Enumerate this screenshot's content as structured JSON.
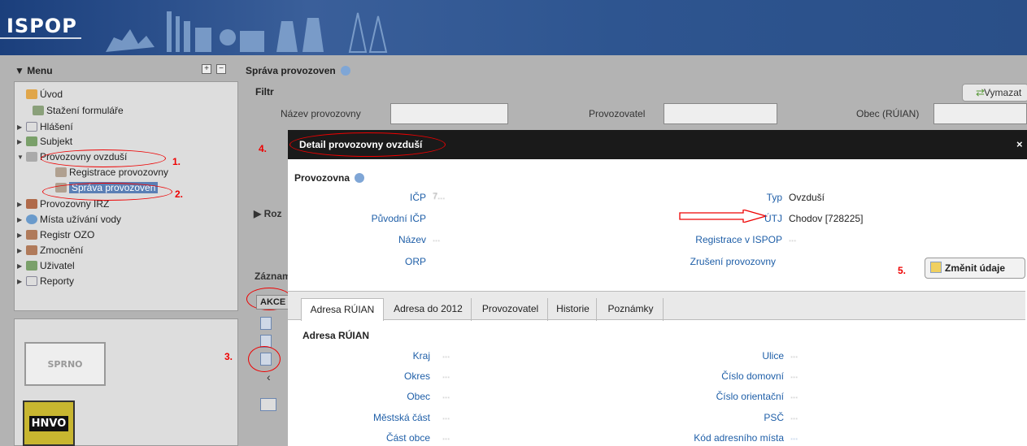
{
  "header": {
    "logo": "ISPOP"
  },
  "menu": {
    "title": "▼ Menu",
    "items": [
      {
        "label": "Úvod"
      },
      {
        "label": "Stažení formuláře"
      },
      {
        "label": "Hlášení"
      },
      {
        "label": "Subjekt"
      },
      {
        "label": "Provozovny ovzduší"
      },
      {
        "label": "Registrace provozovny"
      },
      {
        "label": "Správa provozoven"
      },
      {
        "label": "Provozovny IRZ"
      },
      {
        "label": "Místa užívání vody"
      },
      {
        "label": "Registr OZO"
      },
      {
        "label": "Zmocnění"
      },
      {
        "label": "Uživatel"
      },
      {
        "label": "Reporty"
      }
    ]
  },
  "logos": {
    "first": "SPRNO",
    "second": "HNVO"
  },
  "section": {
    "title": "Správa provozoven",
    "filter": "Filtr",
    "clear": "Vymazat",
    "fields": {
      "name": "Název provozovny",
      "operator": "Provozovatel",
      "municipality": "Obec (RÚIAN)"
    },
    "expand": "▶ Roz",
    "records": "Záznam",
    "actions": "AKCE"
  },
  "annotations": {
    "n1": "1.",
    "n2": "2.",
    "n3": "3.",
    "n4": "4.",
    "n5": "5."
  },
  "modal": {
    "title": "Detail provozovny ovzduší",
    "close": "×",
    "provozovna": "Provozovna",
    "icp_label": "IČP",
    "icp_value": "7...",
    "puvodni_icp_label": "Původní IČP",
    "nazev_label": "Název",
    "nazev_value": "...",
    "orp_label": "ORP",
    "typ_label": "Typ",
    "typ_value": "Ovzduší",
    "utj_label": "ÚTJ",
    "utj_value": "Chodov [728225]",
    "registrace_label": "Registrace v ISPOP",
    "registrace_value": "...",
    "zruseni_label": "Zrušení provozovny",
    "change_button": "Změnit údaje",
    "tabs": [
      "Adresa RÚIAN",
      "Adresa do 2012",
      "Provozovatel",
      "Historie",
      "Poznámky"
    ],
    "address_title": "Adresa RÚIAN",
    "address_left": [
      {
        "label": "Kraj",
        "value": "..."
      },
      {
        "label": "Okres",
        "value": "..."
      },
      {
        "label": "Obec",
        "value": "..."
      },
      {
        "label": "Městská část",
        "value": "..."
      },
      {
        "label": "Část obce",
        "value": "..."
      }
    ],
    "address_right": [
      {
        "label": "Ulice",
        "value": "..."
      },
      {
        "label": "Číslo domovní",
        "value": "..."
      },
      {
        "label": "Číslo orientační",
        "value": "..."
      },
      {
        "label": "PSČ",
        "value": "..."
      },
      {
        "label": "Kód adresního místa",
        "value": "..."
      }
    ]
  }
}
